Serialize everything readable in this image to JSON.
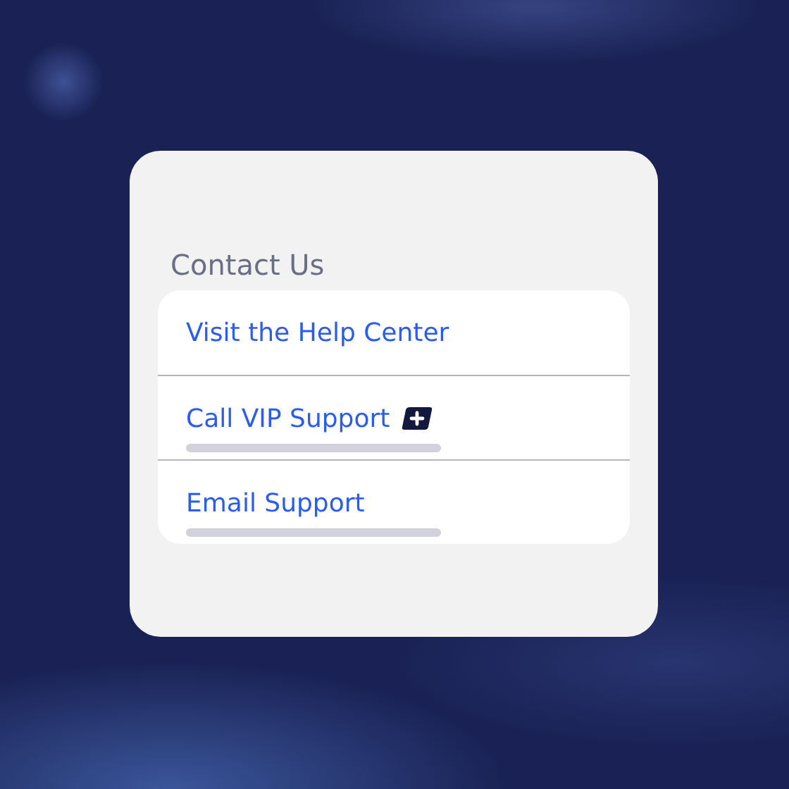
{
  "section": {
    "title": "Contact Us"
  },
  "options": [
    {
      "label": "Visit the Help Center",
      "plus_badge": false,
      "detail_loading": false
    },
    {
      "label": "Call VIP Support",
      "plus_badge": true,
      "detail_loading": true
    },
    {
      "label": "Email Support",
      "plus_badge": false,
      "detail_loading": true
    }
  ]
}
